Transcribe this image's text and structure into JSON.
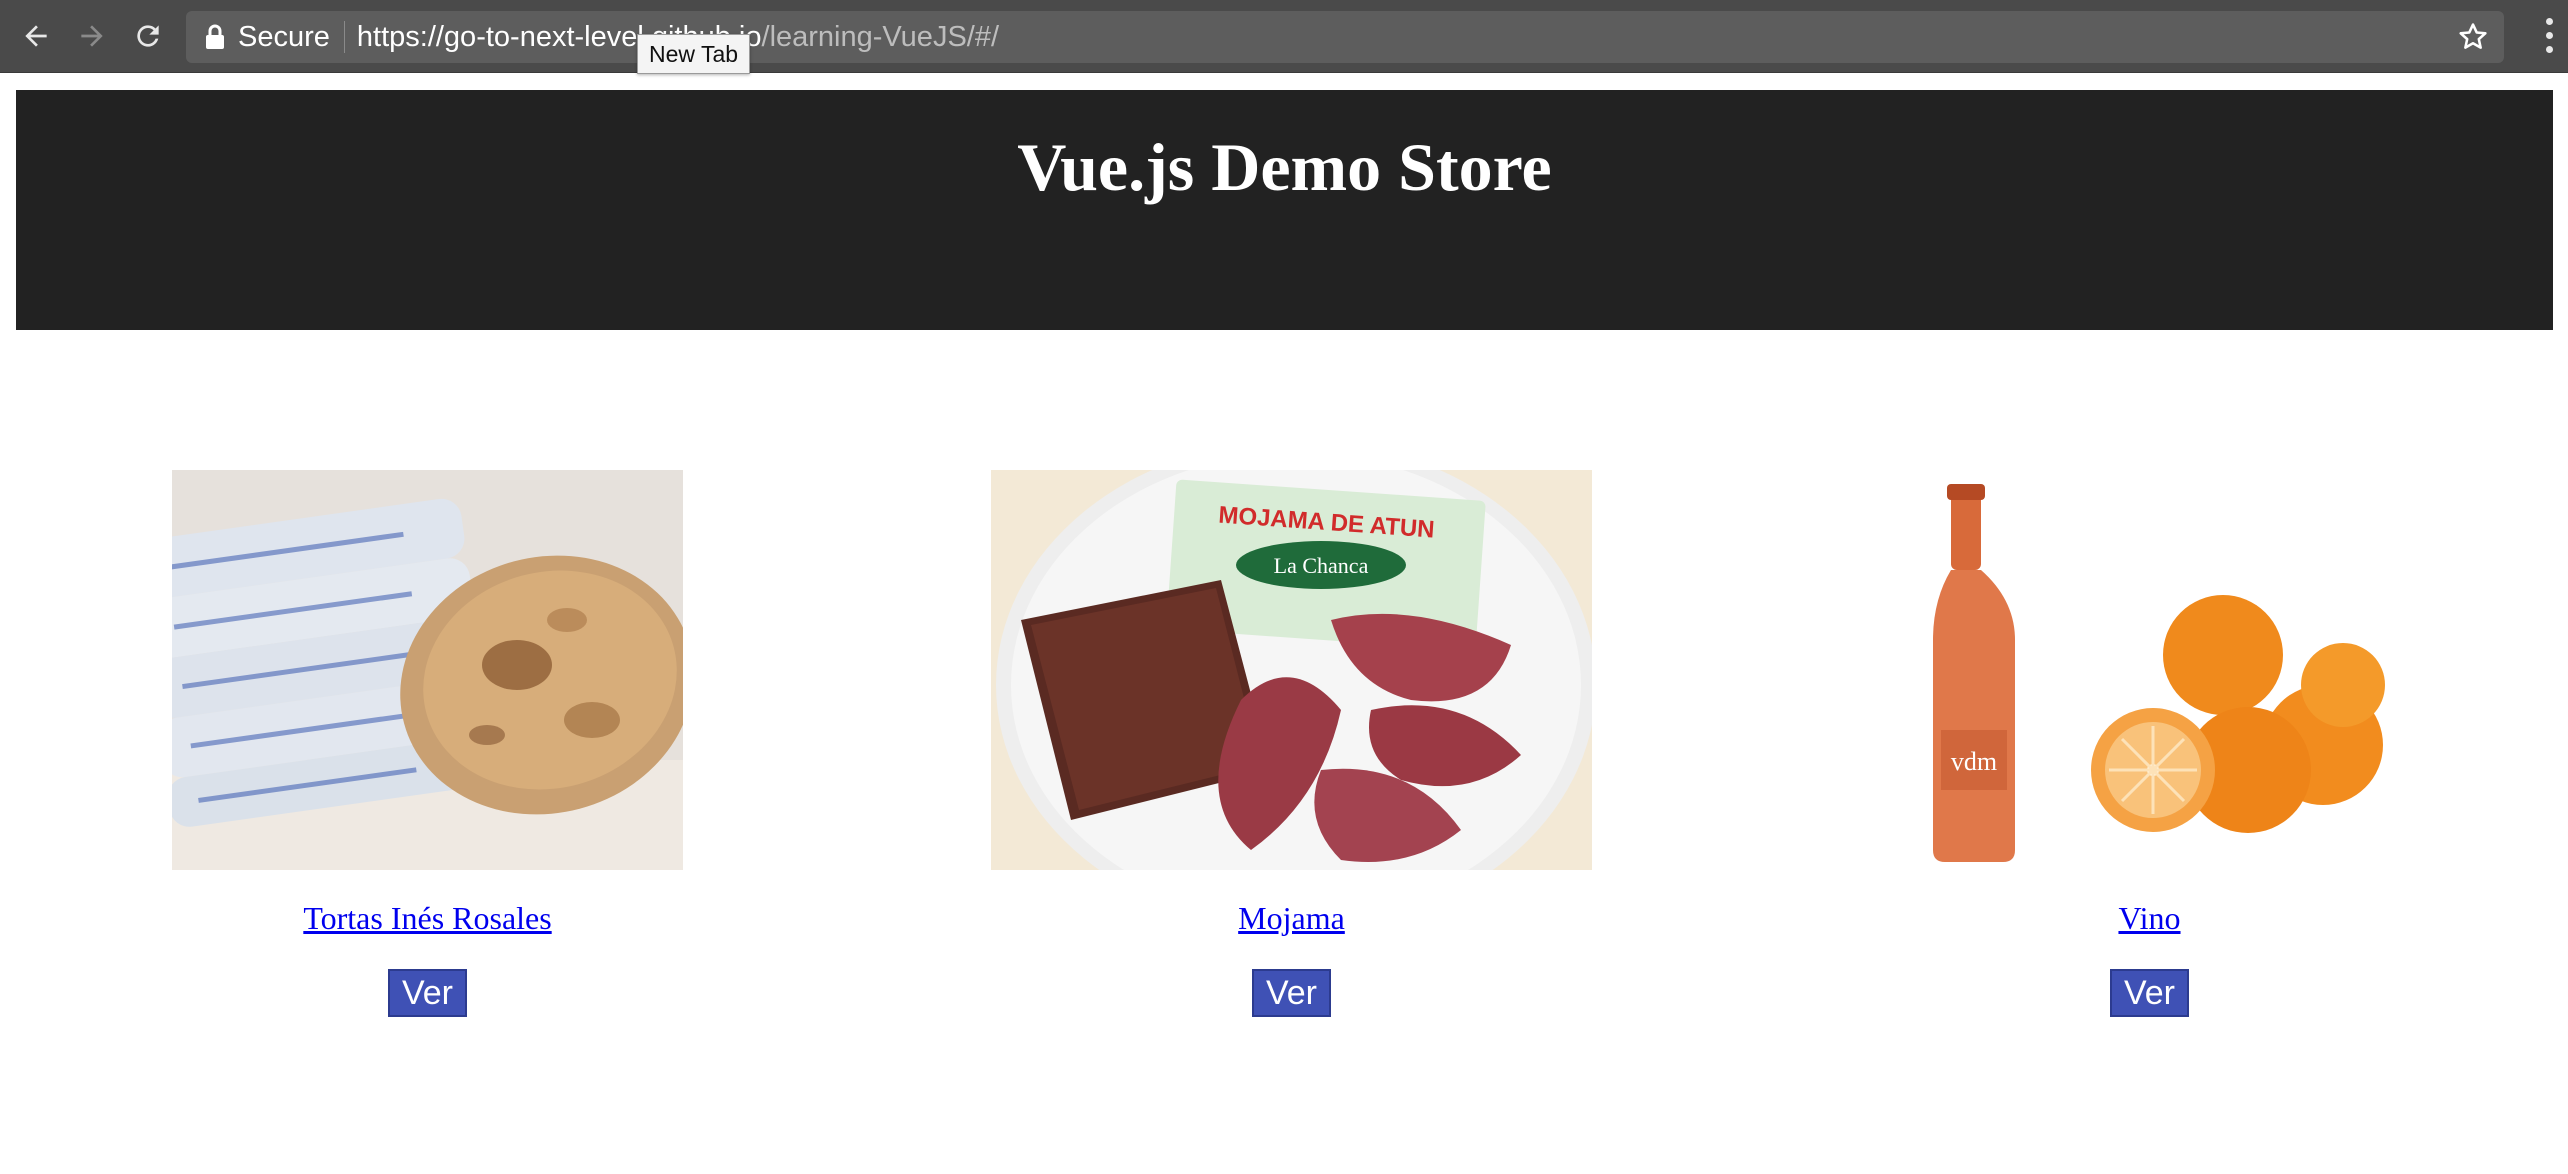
{
  "browser": {
    "secure_label": "Secure",
    "url_host": "https://go-to-next-level.github.io",
    "url_path": "/learning-VueJS/#/",
    "tooltip": "New Tab",
    "icons": [
      "back-arrow-icon",
      "forward-arrow-icon",
      "reload-icon",
      "lock-icon",
      "star-icon",
      "menu-dots-icon"
    ]
  },
  "page": {
    "title": "Vue.js Demo Store"
  },
  "products": [
    {
      "name": "Tortas Inés Rosales",
      "button": "Ver"
    },
    {
      "name": "Mojama",
      "button": "Ver"
    },
    {
      "name": "Vino",
      "button": "Ver"
    }
  ],
  "colors": {
    "header_bg": "#222222",
    "button_bg": "#3f51b5",
    "link": "#0000ee"
  }
}
